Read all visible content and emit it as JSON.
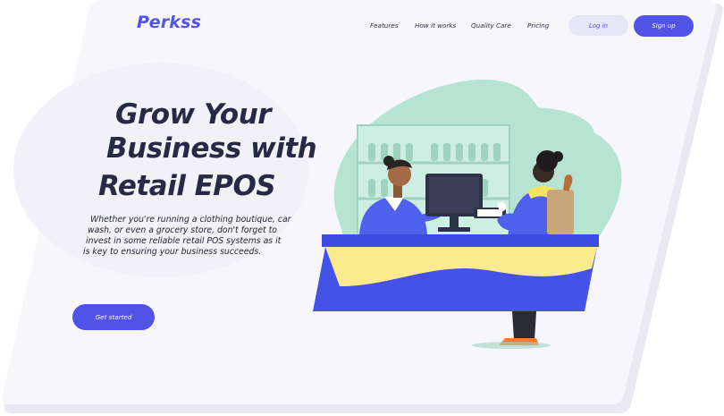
{
  "brand": {
    "name": "Perkss"
  },
  "nav": {
    "links": [
      "Features",
      "How it works",
      "Quality Care",
      "Pricing"
    ],
    "login_label": "Log in",
    "signup_label": "Sign up"
  },
  "hero": {
    "title_lines": [
      "Grow Your",
      "Business with",
      "Retail EPOS"
    ],
    "description_lines": [
      "Whether you're running a clothing boutique, car",
      "wash, or even a grocery store, don't forget to",
      "invest in some reliable retail POS systems as it",
      "is key to ensuring your business succeeds."
    ],
    "cta_label": "Get started"
  },
  "colors": {
    "accent": "#5152e6",
    "text_dark": "#272a45",
    "mint": "#b7e3d3",
    "counter_yellow": "#fbeb8f",
    "card_bg": "#f7f7fb"
  }
}
